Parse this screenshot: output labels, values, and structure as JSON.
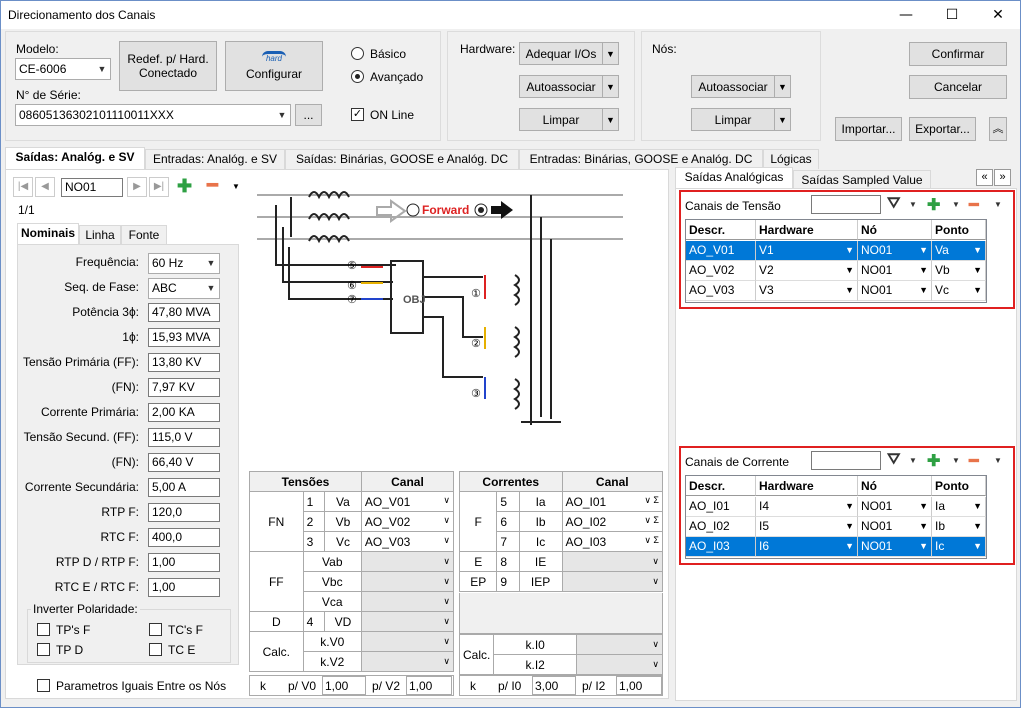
{
  "window": {
    "title": "Direcionamento dos Canais",
    "min": "—",
    "max": "☐",
    "close": "✕"
  },
  "top": {
    "modelo_label": "Modelo:",
    "modelo_value": "CE-6006",
    "serie_label": "N° de Série:",
    "serie_value": "08605136302101110011XXX",
    "serie_btn": "...",
    "redef_btn": "Redef. p/ Hard. Conectado",
    "config_btn": "Configurar",
    "hard_logo": "hard",
    "basico": "Básico",
    "avancado": "Avançado",
    "online": "ON Line",
    "hardware_label": "Hardware:",
    "adequar": "Adequar I/Os",
    "autoassociar": "Autoassociar",
    "limpar": "Limpar",
    "nos_label": "Nós:",
    "nos_auto": "Autoassociar",
    "nos_limpar": "Limpar",
    "confirmar": "Confirmar",
    "cancelar": "Cancelar",
    "importar": "Importar...",
    "exportar": "Exportar..."
  },
  "tabs": [
    "Saídas: Analóg. e SV",
    "Entradas: Analóg. e SV",
    "Saídas: Binárias, GOOSE e Analóg. DC",
    "Entradas: Binárias, GOOSE e Analóg. DC",
    "Lógicas"
  ],
  "nav": {
    "current": "NO01",
    "page": "1/1"
  },
  "subtabs": [
    "Nominais",
    "Linha",
    "Fonte"
  ],
  "params": [
    {
      "label": "Frequência:",
      "value": "60 Hz",
      "combo": true
    },
    {
      "label": "Seq. de Fase:",
      "value": "ABC",
      "combo": true
    },
    {
      "label": "Potência 3ϕ:",
      "value": "47,80 MVA"
    },
    {
      "label": "1ϕ:",
      "value": "15,93 MVA"
    },
    {
      "label": "Tensão Primária (FF):",
      "value": "13,80 KV"
    },
    {
      "label": "(FN):",
      "value": "7,97 KV"
    },
    {
      "label": "Corrente Primária:",
      "value": "2,00 KA"
    },
    {
      "label": "Tensão Secund. (FF):",
      "value": "115,0 V"
    },
    {
      "label": "(FN):",
      "value": "66,40 V"
    },
    {
      "label": "Corrente Secundária:",
      "value": "5,00 A"
    },
    {
      "label": "RTP F:",
      "value": "120,0"
    },
    {
      "label": "RTC F:",
      "value": "400,0"
    },
    {
      "label": "RTP D / RTP F:",
      "value": "1,00"
    },
    {
      "label": "RTC E / RTC F:",
      "value": "1,00"
    }
  ],
  "invert": {
    "title": "Inverter Polaridade:",
    "tpf": "TP's F",
    "tcf": "TC's F",
    "tpd": "TP D",
    "tce": "TC E"
  },
  "iguais": "Parametros Iguais Entre os Nós",
  "diagram": {
    "forward": "Forward",
    "obj": "OBJ",
    "n5": "⑤",
    "n6": "⑥",
    "n7": "⑦",
    "n1": "①",
    "n2": "②",
    "n3": "③"
  },
  "tensoes": {
    "h1": "Tensões",
    "h2": "Canal",
    "fn": "FN",
    "ff": "FF",
    "d": "D",
    "calc": "Calc.",
    "k": "k",
    "rows": [
      {
        "n": "1",
        "name": "Va",
        "ch": "AO_V01"
      },
      {
        "n": "2",
        "name": "Vb",
        "ch": "AO_V02"
      },
      {
        "n": "3",
        "name": "Vc",
        "ch": "AO_V03"
      }
    ],
    "ffrows": [
      "Vab",
      "Vbc",
      "Vca"
    ],
    "drow": {
      "n": "4",
      "name": "VD"
    },
    "calcrows": [
      "k.V0",
      "k.V2"
    ],
    "kv0": "p/ V0",
    "kv0v": "1,00",
    "kv2": "p/ V2",
    "kv2v": "1,00"
  },
  "correntes": {
    "h1": "Correntes",
    "h2": "Canal",
    "f": "F",
    "e": "E",
    "ep": "EP",
    "calc": "Calc.",
    "k": "k",
    "rows": [
      {
        "n": "5",
        "name": "Ia",
        "ch": "AO_I01"
      },
      {
        "n": "6",
        "name": "Ib",
        "ch": "AO_I02"
      },
      {
        "n": "7",
        "name": "Ic",
        "ch": "AO_I03"
      }
    ],
    "erow": {
      "n": "8",
      "name": "IE"
    },
    "eprow": {
      "n": "9",
      "name": "IEP"
    },
    "calcrows": [
      "k.I0",
      "k.I2"
    ],
    "ki0": "p/ I0",
    "ki0v": "3,00",
    "ki2": "p/ I2",
    "ki2v": "1,00"
  },
  "right": {
    "tab1": "Saídas Analógicas",
    "tab2": "Saídas Sampled Value",
    "tensao_title": "Canais de Tensão",
    "corrente_title": "Canais de Corrente",
    "cols": [
      "Descr.",
      "Hardware",
      "Nó",
      "Ponto"
    ],
    "tensao_rows": [
      [
        "AO_V01",
        "V1",
        "NO01",
        "Va"
      ],
      [
        "AO_V02",
        "V2",
        "NO01",
        "Vb"
      ],
      [
        "AO_V03",
        "V3",
        "NO01",
        "Vc"
      ]
    ],
    "corrente_rows": [
      [
        "AO_I01",
        "I4",
        "NO01",
        "Ia"
      ],
      [
        "AO_I02",
        "I5",
        "NO01",
        "Ib"
      ],
      [
        "AO_I03",
        "I6",
        "NO01",
        "Ic"
      ]
    ]
  }
}
